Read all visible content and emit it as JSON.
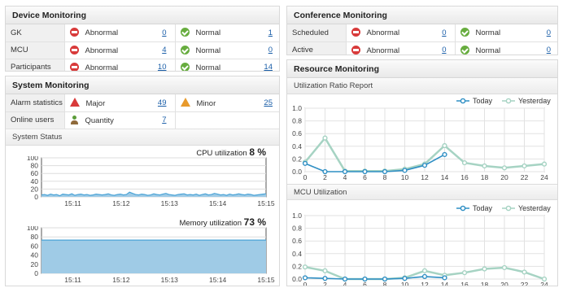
{
  "device_monitoring": {
    "title": "Device Monitoring",
    "rows": [
      {
        "label": "GK",
        "abnormal_label": "Abnormal",
        "abnormal_count": "0",
        "normal_label": "Normal",
        "normal_count": "1"
      },
      {
        "label": "MCU",
        "abnormal_label": "Abnormal",
        "abnormal_count": "4",
        "normal_label": "Normal",
        "normal_count": "0"
      },
      {
        "label": "Participants",
        "abnormal_label": "Abnormal",
        "abnormal_count": "10",
        "normal_label": "Normal",
        "normal_count": "14"
      }
    ]
  },
  "conference_monitoring": {
    "title": "Conference Monitoring",
    "rows": [
      {
        "label": "Scheduled",
        "abnormal_label": "Abnormal",
        "abnormal_count": "0",
        "normal_label": "Normal",
        "normal_count": "0"
      },
      {
        "label": "Active",
        "abnormal_label": "Abnormal",
        "abnormal_count": "0",
        "normal_label": "Normal",
        "normal_count": "0"
      }
    ]
  },
  "system_monitoring": {
    "title": "System Monitoring",
    "alarm_label": "Alarm statistics",
    "major_label": "Major",
    "major_count": "49",
    "minor_label": "Minor",
    "minor_count": "25",
    "online_label": "Online users",
    "quantity_label": "Quantity",
    "quantity_count": "7",
    "status_title": "System Status",
    "cpu_label": "CPU utilization",
    "cpu_value": "8 %",
    "mem_label": "Memory utilization",
    "mem_value": "73 %"
  },
  "resource_monitoring": {
    "title": "Resource Monitoring",
    "utilization_title": "Utilization Ratio Report",
    "mcu_title": "MCU Utilization"
  },
  "colors": {
    "today": "#2f8fc4",
    "yesterday": "#a6d3c3",
    "area_fill": "#9fcbe6",
    "area_line": "#4aa3d6"
  },
  "chart_data": [
    {
      "type": "area",
      "name": "cpu",
      "x_ticks": [
        "15:11",
        "15:12",
        "15:13",
        "15:14",
        "15:15"
      ],
      "y_ticks": [
        "100",
        "80",
        "60",
        "40",
        "20",
        "0"
      ],
      "ylim": [
        0,
        100
      ],
      "values": [
        5,
        6,
        4,
        7,
        5,
        6,
        3,
        7,
        6,
        5,
        8,
        4,
        6,
        7,
        5,
        6,
        4,
        5,
        7,
        6,
        5,
        6,
        8,
        5,
        4,
        6,
        7,
        5,
        6,
        12,
        9,
        6,
        5,
        7,
        6,
        4,
        5,
        8,
        6,
        5,
        7,
        9,
        6,
        5,
        4,
        6,
        7,
        8,
        5,
        6,
        5,
        7,
        4,
        6,
        8,
        5,
        6,
        9,
        7,
        5,
        6,
        4,
        7,
        5,
        6,
        8,
        6,
        5,
        7,
        6,
        4,
        5,
        6,
        7,
        8
      ]
    },
    {
      "type": "area",
      "name": "memory",
      "x_ticks": [
        "15:11",
        "15:12",
        "15:13",
        "15:14",
        "15:15"
      ],
      "y_ticks": [
        "100",
        "80",
        "60",
        "40",
        "20",
        "0"
      ],
      "ylim": [
        0,
        100
      ],
      "values": [
        73,
        73,
        73,
        73,
        73,
        73,
        73,
        73,
        73,
        73,
        73,
        73,
        73,
        73,
        73,
        73,
        73,
        73,
        73,
        73
      ]
    },
    {
      "type": "line",
      "name": "utilization-ratio",
      "x": [
        0,
        2,
        4,
        6,
        8,
        10,
        12,
        14,
        16,
        18,
        20,
        22,
        24
      ],
      "y_ticks": [
        "1.0",
        "0.8",
        "0.6",
        "0.4",
        "0.2",
        "0.0"
      ],
      "ylim": [
        0,
        1
      ],
      "series": [
        {
          "name": "Today",
          "values": [
            0.13,
            0.0,
            0.0,
            0.0,
            0.0,
            0.02,
            0.1,
            0.27
          ]
        },
        {
          "name": "Yesterday",
          "values": [
            0.15,
            0.53,
            0.01,
            0.01,
            0.01,
            0.04,
            0.12,
            0.41,
            0.14,
            0.09,
            0.06,
            0.09,
            0.12
          ]
        }
      ]
    },
    {
      "type": "line",
      "name": "mcu-utilization",
      "x": [
        0,
        2,
        4,
        6,
        8,
        10,
        12,
        14,
        16,
        18,
        20,
        22,
        24
      ],
      "y_ticks": [
        "1.0",
        "0.8",
        "0.6",
        "0.4",
        "0.2",
        "0.0"
      ],
      "ylim": [
        0,
        1
      ],
      "series": [
        {
          "name": "Today",
          "values": [
            0.02,
            0.01,
            0.0,
            0.0,
            0.0,
            0.01,
            0.04,
            0.02
          ]
        },
        {
          "name": "Yesterday",
          "values": [
            0.19,
            0.13,
            0.0,
            0.0,
            0.0,
            0.02,
            0.13,
            0.06,
            0.1,
            0.16,
            0.18,
            0.11,
            0.0
          ]
        }
      ]
    }
  ]
}
